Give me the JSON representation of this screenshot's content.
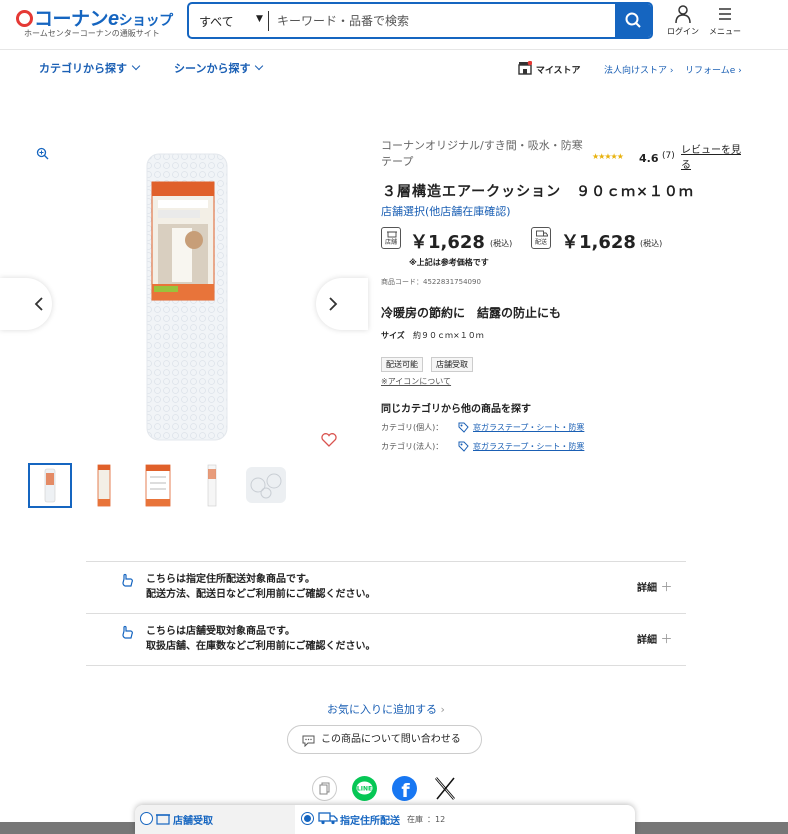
{
  "header": {
    "logo_main": "コーナン",
    "logo_e": "e",
    "logo_shop": "ショップ",
    "tagline": "ホームセンターコーナンの通販サイト",
    "search_category": "すべて",
    "search_placeholder": "キーワード・品番で検索",
    "login_label": "ログイン",
    "menu_label": "メニュー"
  },
  "subnav": {
    "category": "カテゴリから探す",
    "scene": "シーンから探す",
    "mystore": "マイストア",
    "corporate": "法人向けストア",
    "reform": "リフォームe"
  },
  "product": {
    "brand": "コーナンオリジナル/すき間・吸水・防寒テープ",
    "stars": "★★★★★",
    "rating": "4.6",
    "review_count": "(7)",
    "review_link": "レビューを見る",
    "title": "３層構造エアークッション　９０ｃｍ×１０ｍ",
    "store_select": "店舗選択(他店舗在庫確認)",
    "store_badge": "店舗",
    "store_price": "￥1,628",
    "delivery_badge": "配送",
    "delivery_price": "￥1,628",
    "tax_note": "(税込)",
    "ref_note": "※上記は参考価格です",
    "code": "商品コード：4522831754090",
    "catch": "冷暖房の節約に　結露の防止にも",
    "size_label": "サイズ",
    "size_value": "約９０ｃｍ×１０ｍ",
    "tags": [
      "配送可能",
      "店舗受取"
    ],
    "icon_note": "※アイコンについて",
    "same_category": "同じカテゴリから他の商品を探す",
    "cat_personal_label": "カテゴリ(個人)：",
    "cat_personal_value": "窓ガラステープ・シート・防寒",
    "cat_corp_label": "カテゴリ(法人)：",
    "cat_corp_value": "窓ガラステープ・シート・防寒"
  },
  "info": [
    {
      "line1": "こちらは指定住所配送対象商品です。",
      "line2": "配送方法、配送日などご利用前にご確認ください。",
      "detail": "詳細"
    },
    {
      "line1": "こちらは店舗受取対象商品です。",
      "line2": "取扱店舗、在庫数などご利用前にご確認ください。",
      "detail": "詳細"
    }
  ],
  "actions": {
    "favorite": "お気に入りに追加する",
    "inquiry": "この商品について問い合わせる"
  },
  "bottom": {
    "store_pickup": "店舗受取",
    "address_delivery": "指定住所配送",
    "stock_label": "在庫",
    "stock_value": "：12"
  },
  "colors": {
    "brand_blue": "#1565c0",
    "logo_red": "#e53935",
    "line_green": "#06c755",
    "facebook_blue": "#1877f2"
  }
}
